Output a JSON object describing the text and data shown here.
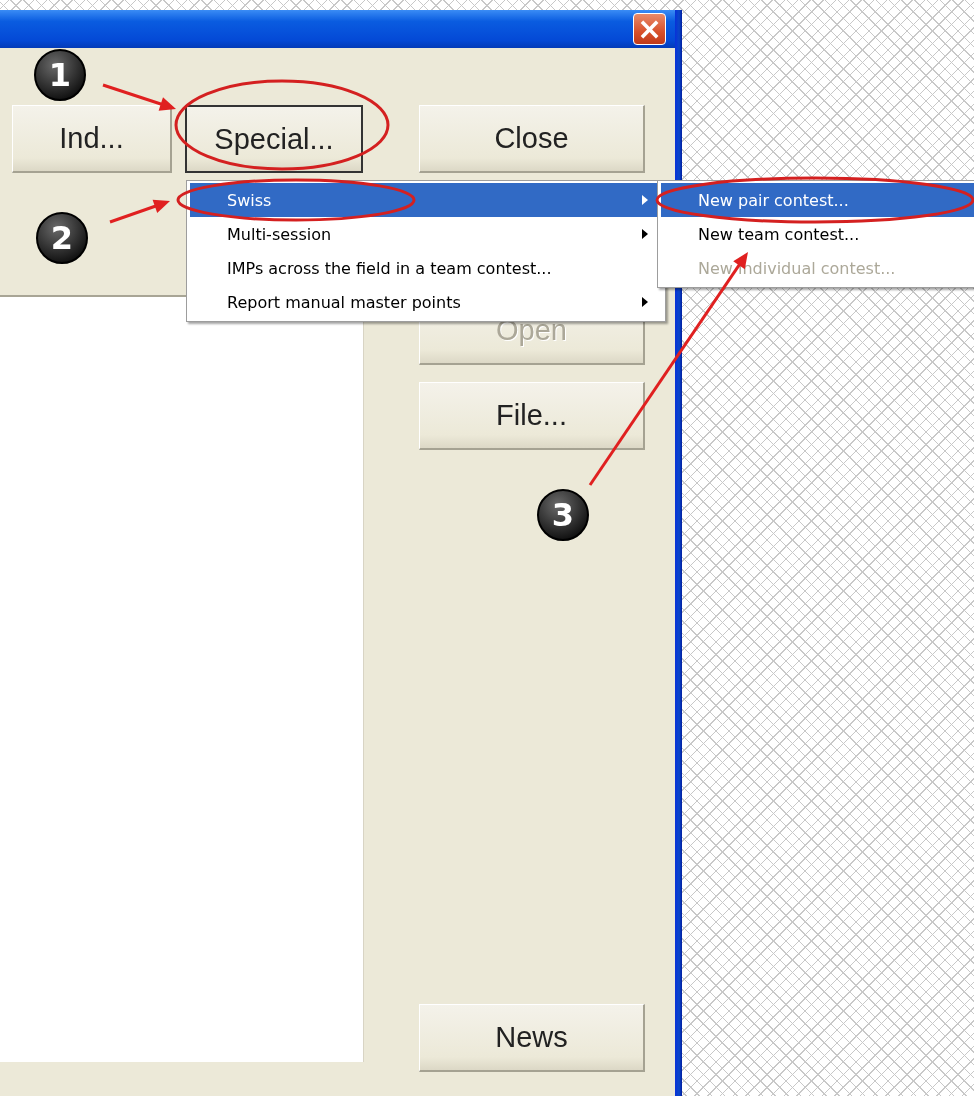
{
  "window": {
    "close_label": "×"
  },
  "top_buttons": [
    {
      "label": "Ind...",
      "focused": false
    },
    {
      "label": "Special...",
      "focused": true
    }
  ],
  "side_buttons": [
    {
      "label": "Close",
      "disabled": false
    },
    {
      "label": "Open",
      "disabled": true
    },
    {
      "label": "File...",
      "disabled": false
    },
    {
      "label": "News",
      "disabled": false
    }
  ],
  "menu": [
    {
      "label": "Swiss",
      "selected": true,
      "submenu": true
    },
    {
      "label": "Multi-session",
      "selected": false,
      "submenu": true
    },
    {
      "label": "IMPs across the field in a team contest...",
      "selected": false,
      "submenu": false
    },
    {
      "label": "Report manual master points",
      "selected": false,
      "submenu": true
    }
  ],
  "submenu": [
    {
      "label": "New pair contest...",
      "selected": true,
      "disabled": false
    },
    {
      "label": "New team contest...",
      "selected": false,
      "disabled": false
    },
    {
      "label": "New individual contest...",
      "selected": false,
      "disabled": true
    }
  ],
  "callouts": [
    "1",
    "2",
    "3"
  ]
}
